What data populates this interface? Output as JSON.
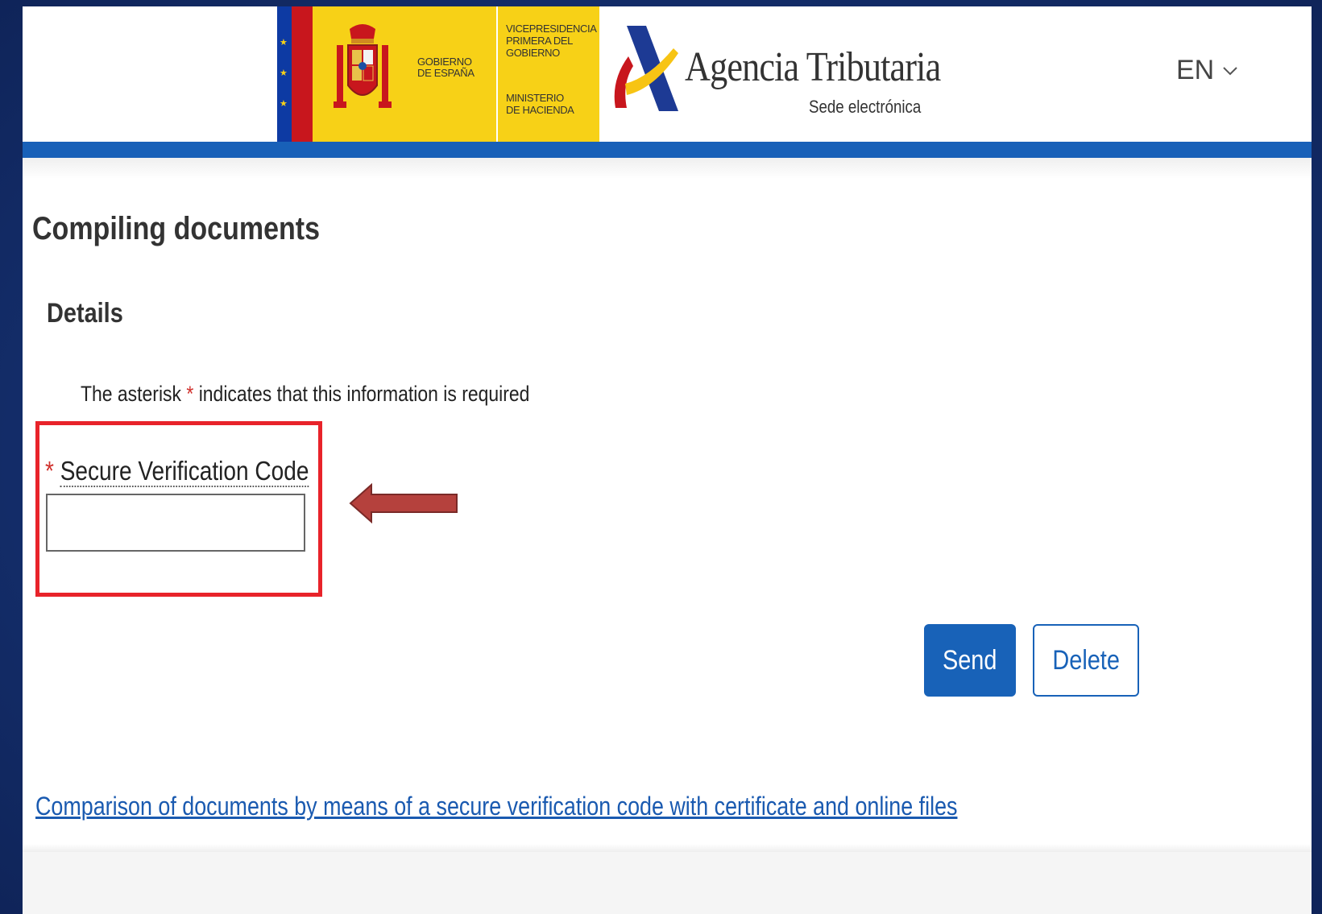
{
  "header": {
    "gov_line1": "GOBIERNO",
    "gov_line2": "DE ESPAÑA",
    "vice_line1": "VICEPRESIDENCIA",
    "vice_line2": "PRIMERA DEL GOBIERNO",
    "ministry_line1": "MINISTERIO",
    "ministry_line2": "DE HACIENDA",
    "agency_name": "Agencia Tributaria",
    "agency_sub": "Sede electrónica",
    "language": "EN",
    "colors": {
      "brand_blue": "#1860b8",
      "gov_yellow": "#f7d117",
      "flag_red": "#c8161d"
    }
  },
  "main": {
    "title": "Compiling documents",
    "subtitle": "Details",
    "required_note_prefix": "The asterisk ",
    "required_star": "*",
    "required_note_suffix": " indicates that this information is required",
    "field": {
      "required_mark": "*",
      "label": "Secure Verification Code",
      "value": "",
      "placeholder": ""
    },
    "buttons": {
      "send": "Send",
      "delete": "Delete"
    },
    "footer_link": "Comparison of documents by means of a secure verification code with certificate and online files"
  },
  "annotation": {
    "highlight_color": "#e8232a",
    "arrow_color": "#b5413d",
    "icon": "arrow-left-icon"
  }
}
